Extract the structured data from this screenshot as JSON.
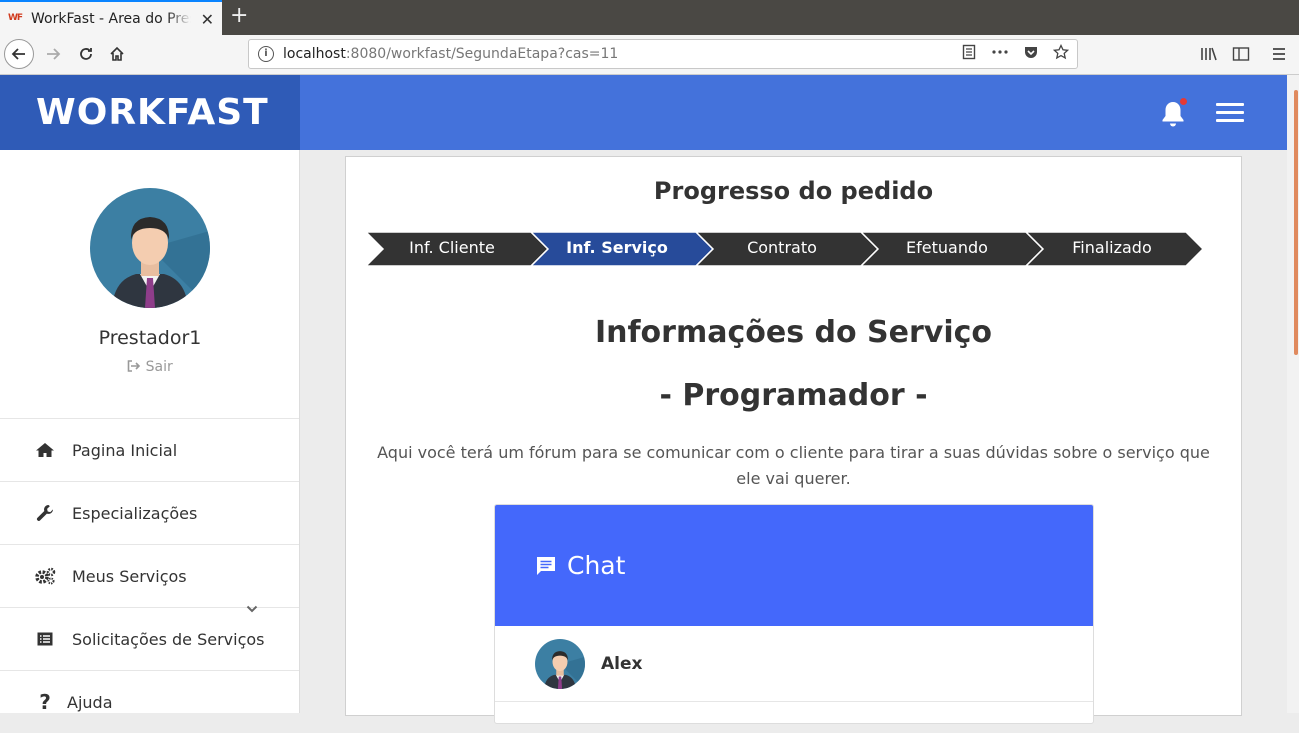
{
  "browser": {
    "tab_title": "WorkFast - Area do Prestador",
    "tab_favicon": "WF",
    "new_tab": "+",
    "close_tab": "✕",
    "url_host": "localhost",
    "url_rest": ":8080/workfast/SegundaEtapa?cas=11"
  },
  "app": {
    "brand": "WORKFAST",
    "notification_indicator_color": "#e53935"
  },
  "sidebar": {
    "user_name": "Prestador1",
    "logout_label": "Sair",
    "items": [
      {
        "label": "Pagina Inicial",
        "icon": "home-icon"
      },
      {
        "label": "Especializações",
        "icon": "wrench-icon"
      },
      {
        "label": "Meus Serviços",
        "icon": "gears-icon"
      },
      {
        "label": "Solicitações de Serviços",
        "icon": "list-icon"
      },
      {
        "label": "Ajuda",
        "icon": "question-icon"
      }
    ]
  },
  "main": {
    "progress_title": "Progresso do pedido",
    "steps": [
      {
        "label": "Inf. Cliente",
        "active": false
      },
      {
        "label": "Inf. Serviço",
        "active": true
      },
      {
        "label": "Contrato",
        "active": false
      },
      {
        "label": "Efetuando",
        "active": false
      },
      {
        "label": "Finalizado",
        "active": false
      }
    ],
    "service_title": "Informações do Serviço",
    "service_subtitle": "- Programador -",
    "description": "Aqui você terá um fórum para se comunicar com o cliente para tirar a suas dúvidas sobre o serviço que ele vai querer.",
    "chat": {
      "title": "Chat",
      "contacts": [
        {
          "name": "Alex"
        }
      ]
    }
  },
  "colors": {
    "brand_dark": "#2f5bb7",
    "header": "#4472db",
    "step_dark": "#333333",
    "step_active": "#274b9a",
    "chat_header": "#4468fb"
  }
}
